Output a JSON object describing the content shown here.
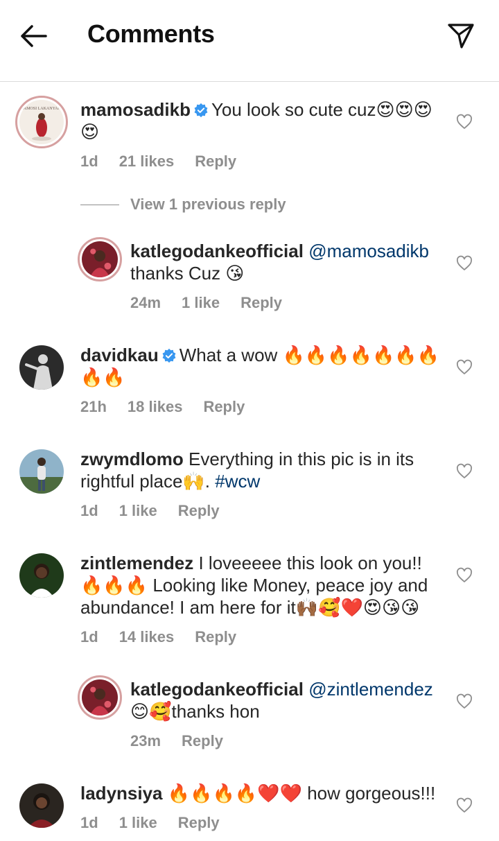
{
  "header": {
    "title": "Comments"
  },
  "comments": [
    {
      "username": "mamosadikb",
      "verified": true,
      "text": "You look so cute cuz😍😍😍😍",
      "time": "1d",
      "likes": "21 likes",
      "reply": "Reply",
      "view_replies": "View 1 previous reply"
    },
    {
      "username": "katlegodankeofficial",
      "mention": "@mamosadikb",
      "text": "thanks Cuz 😘",
      "time": "24m",
      "likes": "1 like",
      "reply": "Reply"
    },
    {
      "username": "davidkau",
      "verified": true,
      "text": "What a wow 🔥🔥🔥🔥🔥🔥🔥🔥🔥",
      "time": "21h",
      "likes": "18 likes",
      "reply": "Reply"
    },
    {
      "username": "zwymdlomo",
      "text": "Everything in this pic is in its rightful place🙌. ",
      "hashtag": "#wcw",
      "time": "1d",
      "likes": "1 like",
      "reply": "Reply"
    },
    {
      "username": "zintlemendez",
      "text": "I loveeeee this look on you!! 🔥🔥🔥 Looking like Money, peace joy and abundance! I am here for it🙌🏾🥰❤️😍😘😘",
      "time": "1d",
      "likes": "14 likes",
      "reply": "Reply"
    },
    {
      "username": "katlegodankeofficial",
      "mention": "@zintlemendez",
      "text": "😊🥰thanks hon",
      "time": "23m",
      "reply": "Reply"
    },
    {
      "username": "ladynsiya",
      "text": "🔥🔥🔥🔥❤️❤️ how gorgeous!!!",
      "time": "1d",
      "likes": "1 like",
      "reply": "Reply"
    }
  ],
  "avatars": {
    "mamosadikb": {
      "lettering": "MAMOSI LAKANYANE",
      "bg": "#f3ede6",
      "accent": "#b8242e"
    },
    "katlegodankeofficial": {
      "bg": "#7a1f2a",
      "accent": "#c8374a"
    },
    "davidkau": {
      "bg": "#2b2b2b",
      "accent": "#d9d9d9"
    },
    "zwymdlomo": {
      "bg": "#8fb3c9",
      "accent": "#4d6b3f"
    },
    "zintlemendez": {
      "bg": "#1f3a1a",
      "accent": "#ffffff"
    },
    "ladynsiya": {
      "bg": "#2a2520",
      "accent": "#8a1f25"
    }
  },
  "colors": {
    "text": "#262626",
    "secondary": "#8e8e8e",
    "link": "#00376b",
    "verified": "#3897f0",
    "divider": "#dbdbdb"
  },
  "icons": {
    "back": "arrow-left-icon",
    "send": "paper-plane-icon",
    "like": "heart-outline-icon",
    "verified": "verified-badge-icon"
  }
}
